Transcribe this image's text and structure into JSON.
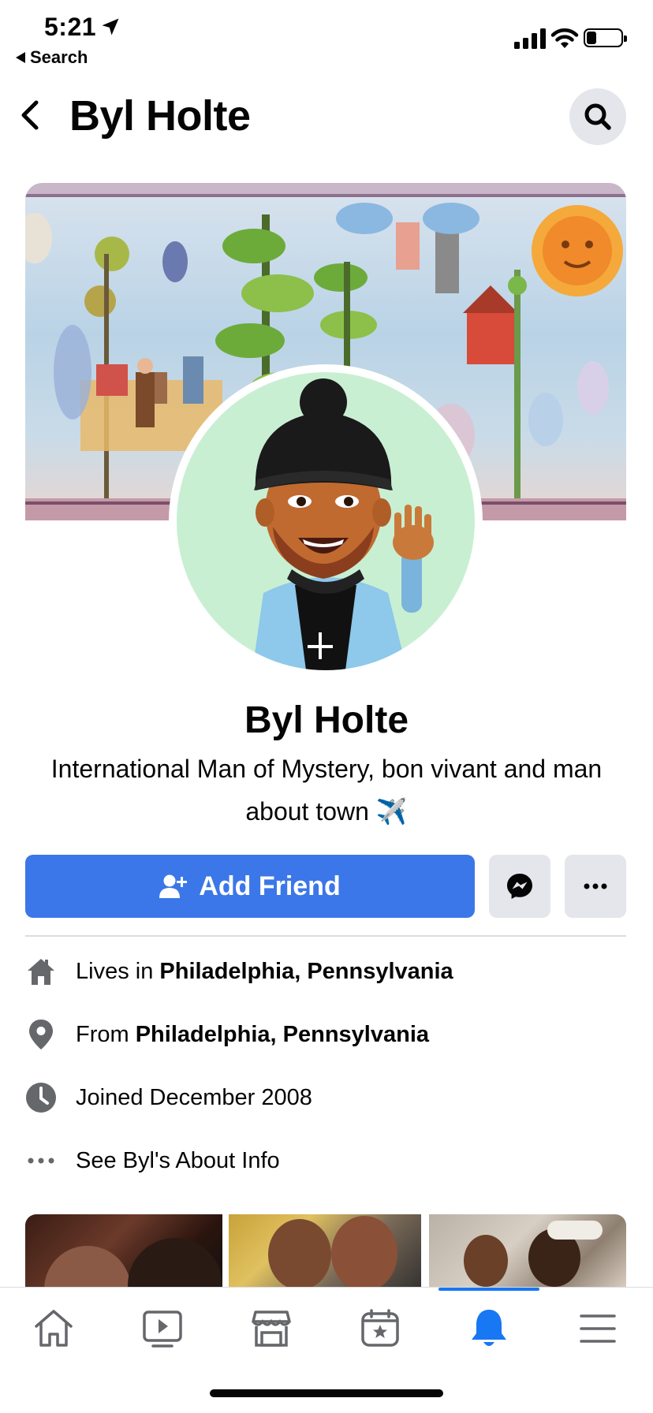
{
  "status_bar": {
    "time": "5:21",
    "back_label": "Search"
  },
  "header": {
    "title": "Byl Holte"
  },
  "profile": {
    "name": "Byl Holte",
    "bio": "International Man of Mystery, bon vivant and man about town ✈️"
  },
  "actions": {
    "add_friend_label": "Add Friend"
  },
  "intro": [
    {
      "prefix": "Lives in ",
      "bold": "Philadelphia, Pennsylvania",
      "icon": "home-icon"
    },
    {
      "prefix": "From ",
      "bold": "Philadelphia, Pennsylvania",
      "icon": "location-pin-icon"
    },
    {
      "prefix": "Joined December 2008",
      "bold": "",
      "icon": "clock-icon"
    },
    {
      "prefix": "See Byl's About Info",
      "bold": "",
      "icon": "more-dots-icon"
    }
  ],
  "tabbar": {
    "items": [
      "home-icon",
      "watch-icon",
      "marketplace-icon",
      "pages-icon",
      "notifications-icon",
      "menu-icon"
    ],
    "active": "notifications-icon"
  },
  "colors": {
    "primary": "#3b77e8",
    "active_tab": "#1877f2",
    "icon_gray": "#65676b",
    "button_gray": "#e4e6eb"
  }
}
